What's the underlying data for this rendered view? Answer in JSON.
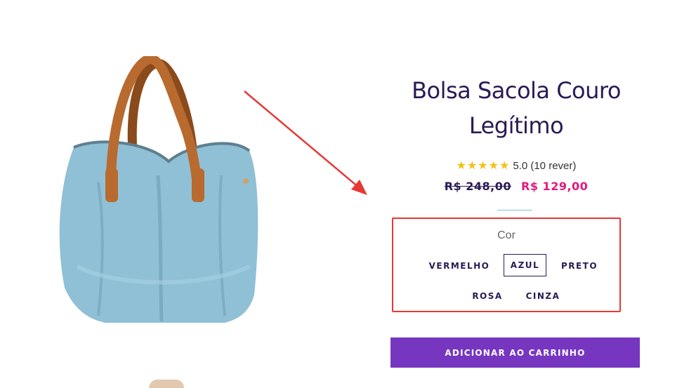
{
  "product": {
    "title": "Bolsa Sacola Couro Legítimo",
    "stars": "★★★★★",
    "rating_text": "5.0 (10 rever)",
    "old_price": "R$ 248,00",
    "new_price": "R$ 129,00"
  },
  "variant": {
    "label": "Cor",
    "options": [
      "VERMELHO",
      "AZUL",
      "PRETO",
      "ROSA",
      "CINZA"
    ],
    "selected": "AZUL"
  },
  "cart": {
    "button_label": "ADICIONAR AO CARRINHO"
  },
  "colors": {
    "title": "#2b1a55",
    "sale_price": "#e0197d",
    "stars": "#f2c10f",
    "button": "#7636c0",
    "annotation": "#e53935",
    "bag_body": "#8fc0d6",
    "bag_handles": "#b86a2f"
  }
}
